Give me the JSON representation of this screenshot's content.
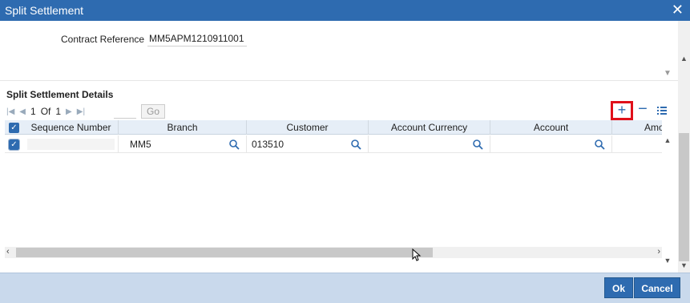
{
  "window": {
    "title": "Split Settlement",
    "close_glyph": "✕"
  },
  "contract": {
    "label": "Contract Reference",
    "value": "MM5APM1210911001"
  },
  "section": {
    "title": "Split Settlement Details"
  },
  "pager": {
    "current": "1",
    "of_label": "Of",
    "total": "1",
    "go_label": "Go"
  },
  "toolbar": {
    "add_glyph": "+",
    "delete_glyph": "−"
  },
  "table": {
    "columns": [
      "Sequence Number",
      "Branch",
      "Customer",
      "Account Currency",
      "Account",
      "Amo"
    ],
    "rows": [
      {
        "checked": true,
        "sequence_number": "",
        "branch": "MM5",
        "customer": "013510",
        "account_currency": "",
        "account": ""
      }
    ]
  },
  "footer": {
    "ok_label": "Ok",
    "cancel_label": "Cancel"
  },
  "colors": {
    "titlebar": "#2e6bb0",
    "footer": "#c9d9ec",
    "highlight": "#e0101a"
  }
}
